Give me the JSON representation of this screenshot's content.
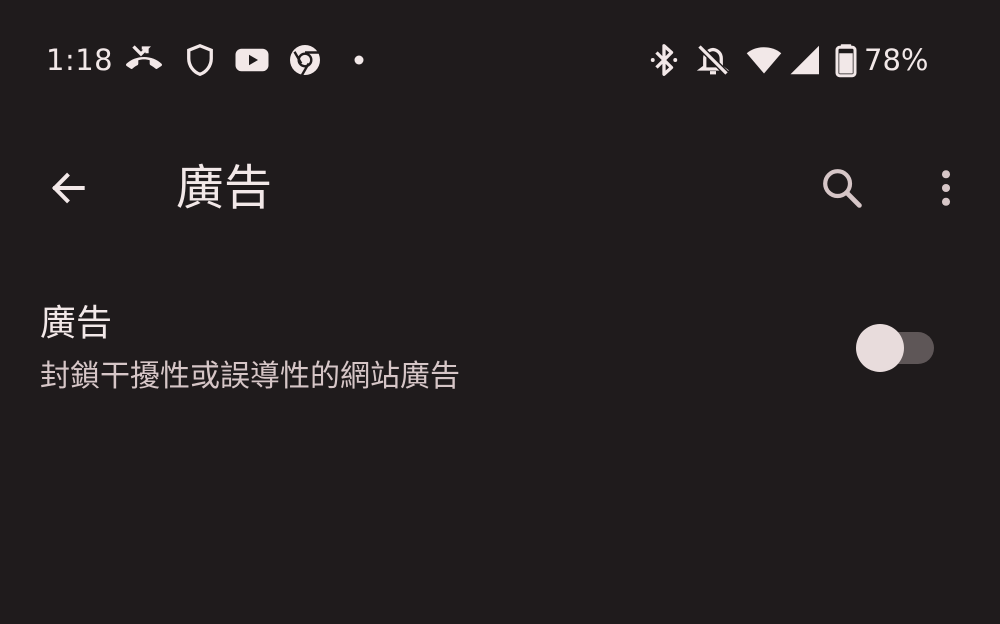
{
  "status_bar": {
    "time": "1:18",
    "battery_percent": "78%",
    "left_icons": [
      "missed-call-icon",
      "shield-icon",
      "youtube-icon",
      "chrome-icon",
      "notification-dot-icon"
    ],
    "right_icons": [
      "bluetooth-icon",
      "notifications-off-icon",
      "wifi-icon",
      "signal-icon",
      "battery-icon"
    ]
  },
  "app_bar": {
    "title": "廣告",
    "back_icon": "arrow-back-icon",
    "search_icon": "search-icon",
    "more_icon": "more-vert-icon"
  },
  "setting": {
    "title": "廣告",
    "summary": "封鎖干擾性或誤導性的網站廣告",
    "toggle_on": false
  },
  "colors": {
    "background": "#1f1b1c",
    "text": "#f2e8e8",
    "summary_text": "#d6c6c7",
    "toggle_track": "#5e5657",
    "toggle_thumb": "#e8dcdc"
  }
}
